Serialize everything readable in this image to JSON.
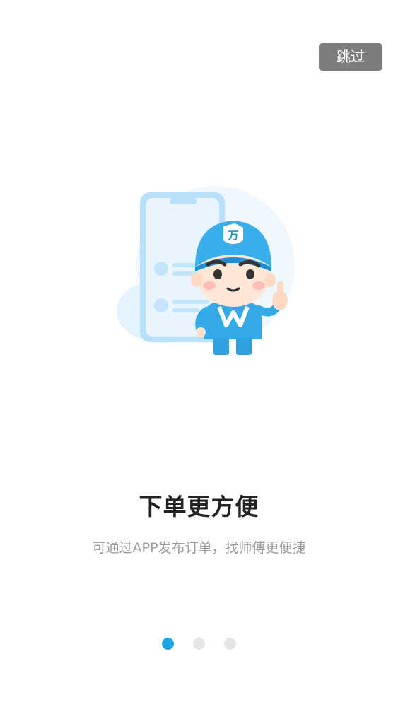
{
  "header": {
    "skip_label": "跳过"
  },
  "illustration": {
    "badge_text": "万",
    "shirt_letter": "W"
  },
  "content": {
    "title": "下单更方便",
    "subtitle": "可通过APP发布订单，找师傅更便捷"
  },
  "pager": {
    "total": 3,
    "current": 1
  },
  "colors": {
    "accent": "#1aa6e8",
    "dot_inactive": "#e6e6e6",
    "skip_bg": "#7d7d7d",
    "title": "#222222",
    "subtitle": "#9b9b9b"
  },
  "icons": [
    "mascot-illustration",
    "phone-illustration"
  ]
}
